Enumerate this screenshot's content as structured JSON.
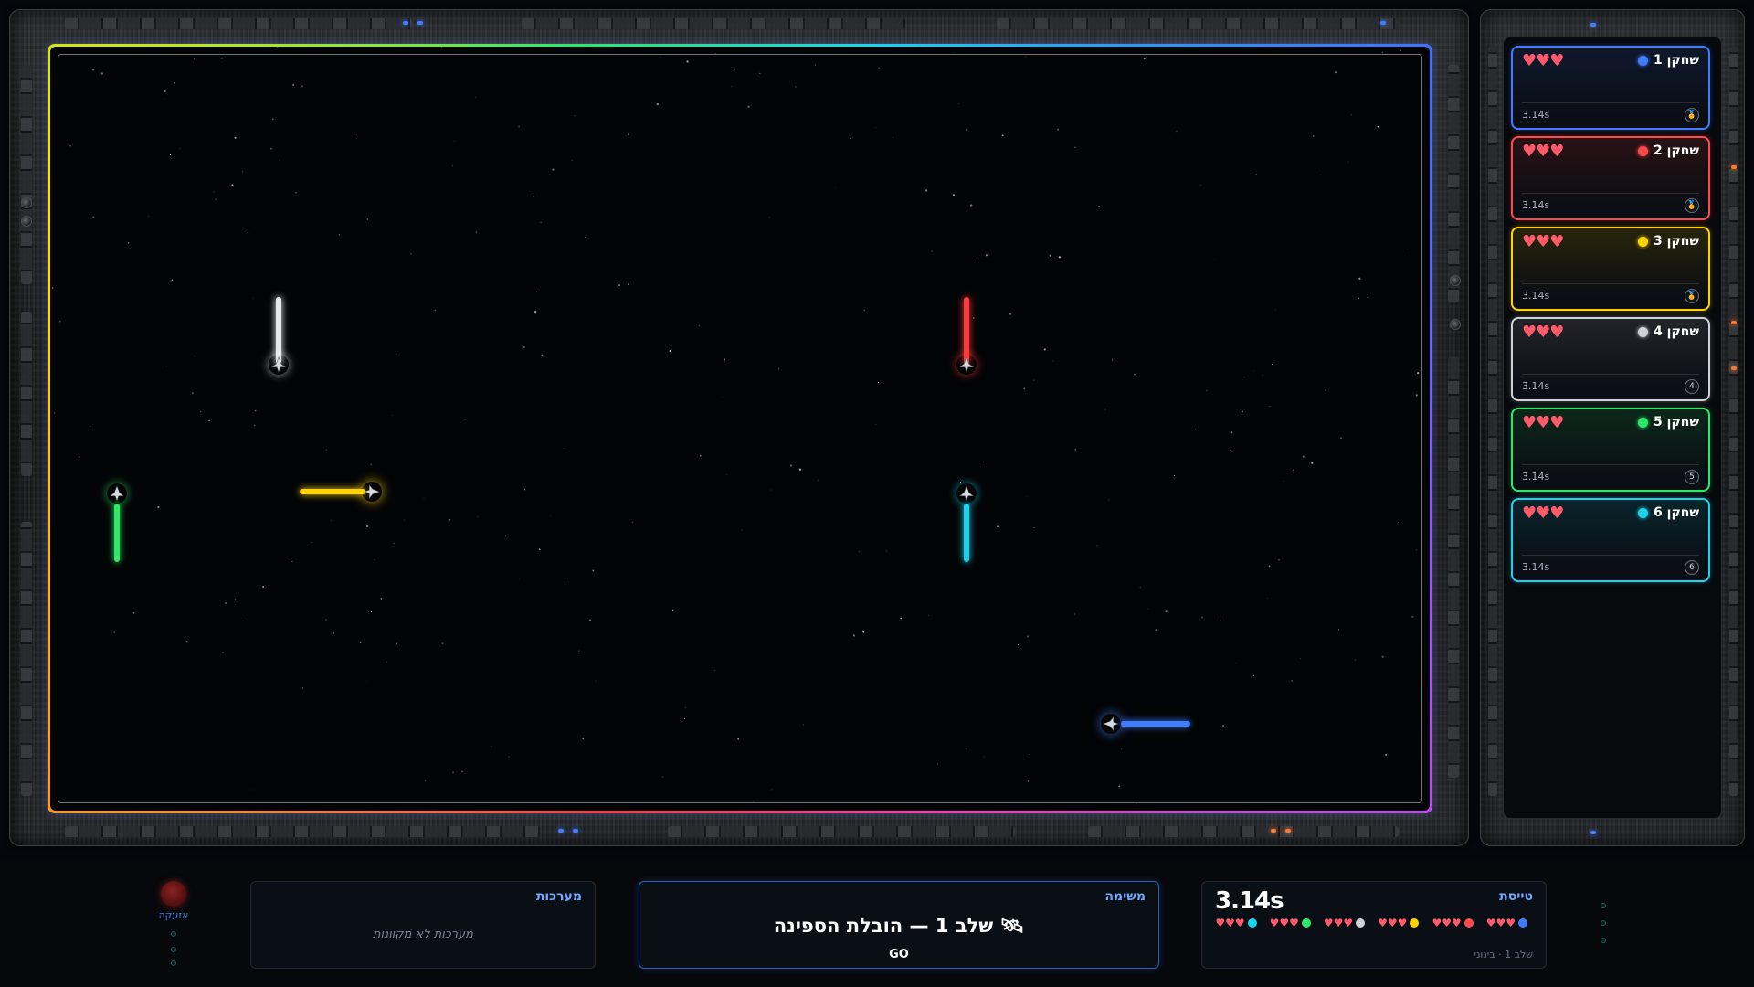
{
  "players": [
    {
      "name": "שחקן 1",
      "color": "#3f7cff",
      "hearts": "♥♥♥",
      "time": "3.14s",
      "badge": "🏅"
    },
    {
      "name": "שחקן 2",
      "color": "#ff4a4a",
      "hearts": "♥♥♥",
      "time": "3.14s",
      "badge": "🏅"
    },
    {
      "name": "שחקן 3",
      "color": "#ffd400",
      "hearts": "♥♥♥",
      "time": "3.14s",
      "badge": "🏅"
    },
    {
      "name": "שחקן 4",
      "color": "#cfd3d9",
      "hearts": "♥♥♥",
      "time": "3.14s",
      "badge": "4"
    },
    {
      "name": "שחקן 5",
      "color": "#2ee86a",
      "hearts": "♥♥♥",
      "time": "3.14s",
      "badge": "5"
    },
    {
      "name": "שחקן 6",
      "color": "#18d4f0",
      "hearts": "♥♥♥",
      "time": "3.14s",
      "badge": "6"
    }
  ],
  "hud": {
    "alarm_label": "אזעקה",
    "systems_title": "מערכות",
    "systems_empty": "מערכות לא מקוונות",
    "mission_title": "משימה",
    "mission_text": "שלב 1 — הובלת הספינה",
    "mission_icon": "🛰",
    "mission_status": "GO",
    "flight_title": "טייסת",
    "flight_time": "3.14s",
    "flight_hearts": "♥♥♥",
    "flight_footer": "שלב 1 · בינוני"
  },
  "icons": {
    "ship": "spaceship-icon",
    "alarm": "alarm-light-icon",
    "badge": "medal-icon"
  }
}
